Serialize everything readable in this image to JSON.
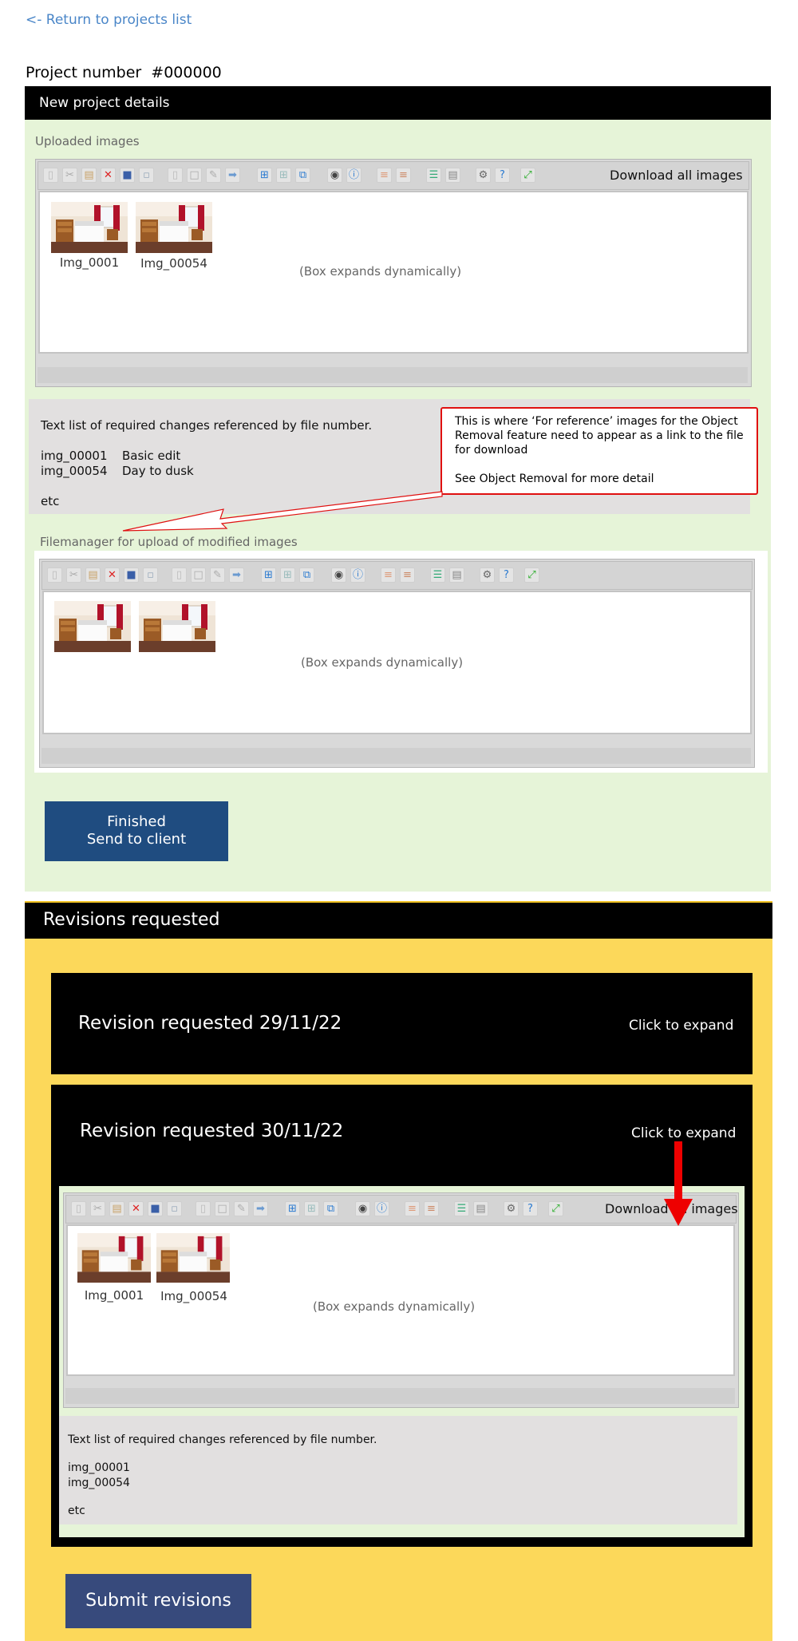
{
  "nav": {
    "back_link": "<- Return to projects list"
  },
  "project": {
    "number_label": "Project number",
    "number_value": "#000000"
  },
  "details": {
    "title": "New project details",
    "uploaded_label": "Uploaded images",
    "uploaded_fm": {
      "download_label": "Download all images",
      "expands_note": "(Box expands dynamically)",
      "thumbs": [
        "Img_0001",
        "Img_00054"
      ]
    },
    "changes": {
      "heading": "Text list of required changes referenced by file number.",
      "rows": [
        {
          "file": "img_00001",
          "change": "Basic edit"
        },
        {
          "file": "img_00054",
          "change": "Day to dusk"
        }
      ],
      "etc": "etc"
    },
    "callout": {
      "line1": "This is where ‘For reference’ images for the Object Removal feature need to appear as a link to the file for download",
      "line2": "See Object Removal for more detail"
    },
    "modified_label": "Filemanager for upload of modified images",
    "modified_fm": {
      "expands_note": "(Box expands dynamically)"
    },
    "finish_button": {
      "line1": "Finished",
      "line2": "Send to client"
    }
  },
  "revisions": {
    "title": "Revisions requested",
    "items": [
      {
        "title": "Revision requested 29/11/22",
        "expand": "Click to expand"
      },
      {
        "title": "Revision requested 30/11/22",
        "expand": "Click to expand"
      }
    ],
    "fm": {
      "download_label": "Download all images",
      "expands_note": "(Box expands dynamically)",
      "thumbs": [
        "Img_0001",
        "Img_00054"
      ]
    },
    "changes": {
      "heading": "Text list of required changes referenced by file number.",
      "files": [
        "img_00001",
        "img_00054"
      ],
      "etc": "etc"
    },
    "submit_button": "Submit revisions"
  },
  "colors": {
    "green_panel": "#e6f4d8",
    "yellow_panel": "#fcd85a",
    "callout_red": "#e01010",
    "arrow_red": "#ee0000",
    "finish_blue": "#1f4c80",
    "submit_navy": "#374a7c"
  },
  "toolbar_icons": [
    "new-file-icon",
    "cut-icon",
    "paste-icon",
    "delete-icon",
    "save-icon",
    "rename-icon",
    "copy-icon",
    "select-icon",
    "edit-icon",
    "move-icon",
    "large-grid-icon",
    "small-grid-icon",
    "resize-icon",
    "preview-icon",
    "info-icon",
    "import-icon",
    "export-icon",
    "list-view-icon",
    "details-icon",
    "settings-icon",
    "help-icon",
    "fullscreen-icon"
  ]
}
